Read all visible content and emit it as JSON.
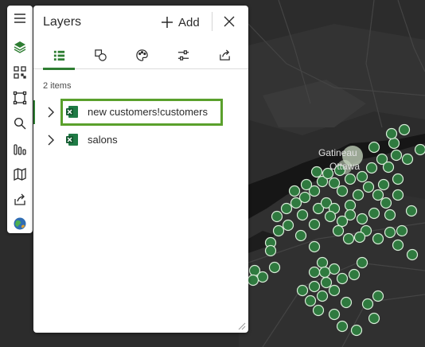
{
  "panel": {
    "title": "Layers",
    "add_label": "Add",
    "item_count": "2 items"
  },
  "toolbar": {
    "tools": [
      "menu-icon",
      "layers-icon",
      "qr-grid-icon",
      "select-frame-icon",
      "search-icon",
      "chart-bars-icon",
      "map-icon",
      "share-icon",
      "basemap-globe-icon"
    ]
  },
  "tabs": [
    "list-icon",
    "shapes-icon",
    "palette-icon",
    "sliders-icon",
    "share-icon"
  ],
  "layers": [
    {
      "name": "new customers!customers",
      "selected": true
    },
    {
      "name": "salons",
      "selected": false
    }
  ],
  "map": {
    "labels": [
      "Gatineau",
      "Ottawa"
    ],
    "colors": {
      "background": "#2b2b2b",
      "river": "#171717",
      "point_fill": "#2f7a3f",
      "point_stroke": "#d8ecd8"
    }
  }
}
